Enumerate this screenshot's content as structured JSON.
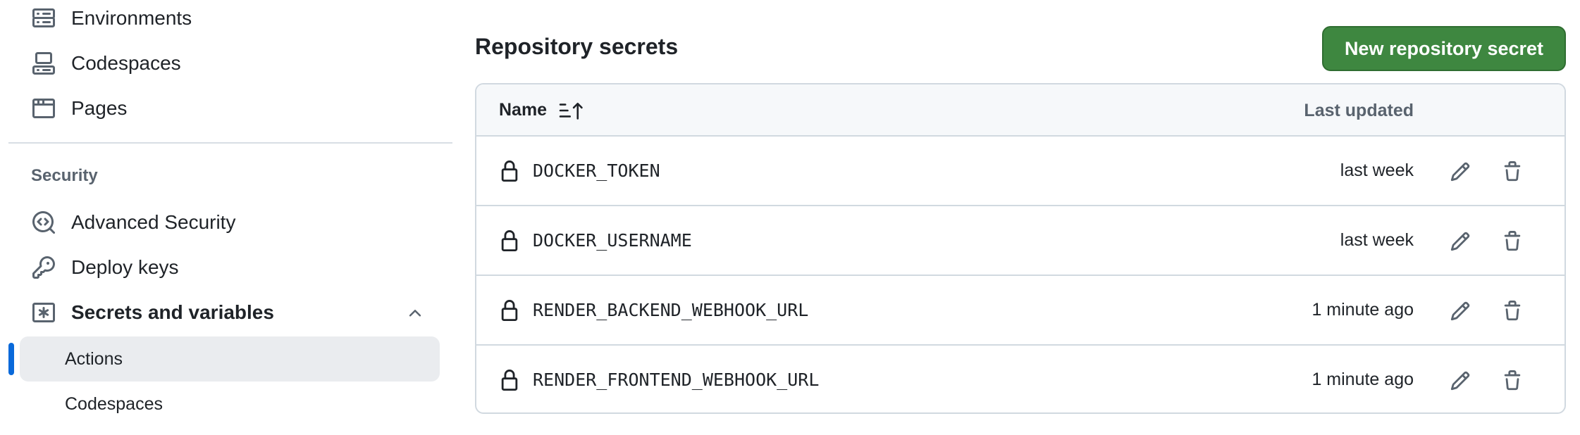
{
  "sidebar": {
    "items": [
      {
        "label": "Environments",
        "icon": "server-icon"
      },
      {
        "label": "Codespaces",
        "icon": "codespaces-icon"
      },
      {
        "label": "Pages",
        "icon": "browser-icon"
      }
    ],
    "security_heading": "Security",
    "security_items": [
      {
        "label": "Advanced Security",
        "icon": "codescan-icon"
      },
      {
        "label": "Deploy keys",
        "icon": "key-icon"
      },
      {
        "label": "Secrets and variables",
        "icon": "asterisk-icon",
        "expanded": true
      }
    ],
    "sub_items": [
      {
        "label": "Actions",
        "active": true
      },
      {
        "label": "Codespaces",
        "active": false
      }
    ]
  },
  "main": {
    "title": "Repository secrets",
    "new_button_label": "New repository secret",
    "table": {
      "columns": {
        "name": "Name",
        "last_updated": "Last updated"
      },
      "rows": [
        {
          "name": "DOCKER_TOKEN",
          "updated": "last week"
        },
        {
          "name": "DOCKER_USERNAME",
          "updated": "last week"
        },
        {
          "name": "RENDER_BACKEND_WEBHOOK_URL",
          "updated": "1 minute ago"
        },
        {
          "name": "RENDER_FRONTEND_WEBHOOK_URL",
          "updated": "1 minute ago"
        }
      ]
    }
  },
  "colors": {
    "primary_button": "#3e8740",
    "active_indicator": "#0969da",
    "active_bg": "#eaecef",
    "border": "#d1d9e0",
    "muted_text": "#59636e"
  }
}
